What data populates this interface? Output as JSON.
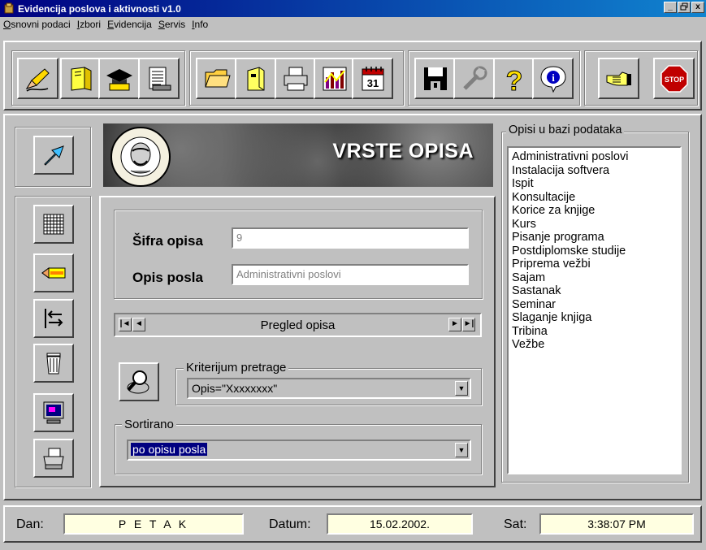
{
  "window": {
    "title": "Evidencija poslova i aktivnosti v1.0",
    "buttons": [
      "_",
      "□",
      "x"
    ]
  },
  "menu": [
    {
      "label": "Osnovni podaci",
      "underline": "O",
      "rest": "snovni podaci"
    },
    {
      "label": "Izbori",
      "underline": "I",
      "rest": "zbori"
    },
    {
      "label": "Evidencija",
      "underline": "E",
      "rest": "videncija"
    },
    {
      "label": "Servis",
      "underline": "S",
      "rest": "ervis"
    },
    {
      "label": "Info",
      "underline": "I",
      "rest": "nfo"
    }
  ],
  "toolbar": {
    "icons": [
      "edit-icon",
      "book-icon",
      "graduation-cap-icon",
      "report-icon",
      "folder-icon",
      "archive-icon",
      "print-icon",
      "chart-icon",
      "calendar-icon",
      "save-disk-icon",
      "tools-icon",
      "help-icon",
      "info-icon",
      "exit-hand-icon",
      "stop-icon"
    ],
    "calendar_day": "31",
    "stop_label": "STOP"
  },
  "banner": {
    "title": "VRSTE OPISA"
  },
  "form": {
    "sifra_label": "Šifra opisa",
    "sifra_value": "9",
    "opis_label": "Opis posla",
    "opis_value": "Administrativni poslovi"
  },
  "navigator": {
    "label": "Pregled opisa",
    "first": "|◄",
    "prev": "◄",
    "next": "►",
    "last": "►|"
  },
  "search": {
    "group_title": "Kriterijum pretrage",
    "value": "Opis=\"Xxxxxxxx\""
  },
  "sort": {
    "group_title": "Sortirano",
    "value": "po opisu posla"
  },
  "list": {
    "group_title": "Opisi u bazi podataka",
    "items": [
      "Administrativni poslovi",
      "Instalacija softvera",
      "Ispit",
      "Konsultacije",
      "Korice za knjige",
      "Kurs",
      "Pisanje programa",
      "Postdiplomske studije",
      "Priprema vežbi",
      "Sajam",
      "Sastanak",
      "Seminar",
      "Slaganje knjiga",
      "Tribina",
      "Vežbe"
    ]
  },
  "status": {
    "dan_label": "Dan:",
    "dan_value": "P E T A K",
    "datum_label": "Datum:",
    "datum_value": "15.02.2002.",
    "sat_label": "Sat:",
    "sat_value": "3:38:07 PM"
  },
  "colors": {
    "title_bar": "#000080",
    "selection": "#000080",
    "status_field": "#ffffe1",
    "face": "#c0c0c0"
  }
}
